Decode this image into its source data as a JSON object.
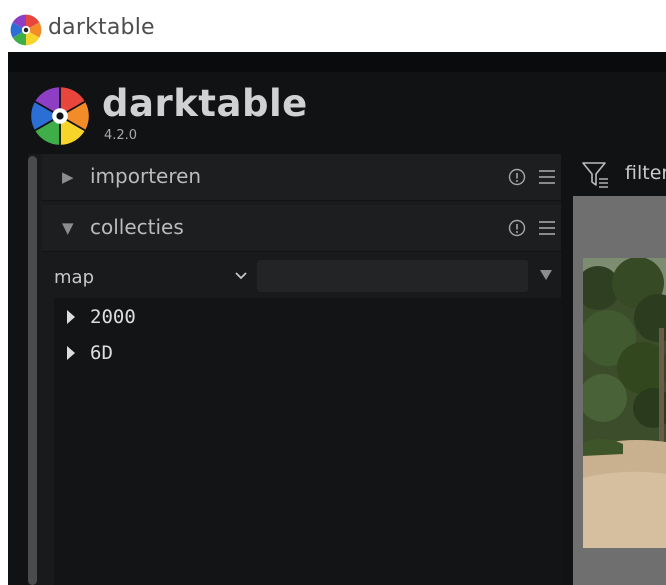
{
  "window": {
    "title": "darktable",
    "icon": "darktable-aperture-logo"
  },
  "brand": {
    "name": "darktable",
    "version": "4.2.0",
    "logo_icon": "darktable-aperture-logo"
  },
  "modules": {
    "import": {
      "label": "importeren",
      "expanded": false
    },
    "collections": {
      "label": "collecties",
      "expanded": true
    }
  },
  "collections": {
    "property": "map",
    "search_value": "",
    "tree": [
      {
        "label": "2000"
      },
      {
        "label": "6D"
      }
    ]
  },
  "toolbar": {
    "filter_label": "filter"
  },
  "icons": {
    "info": "info-icon",
    "menu": "hamburger-menu-icon",
    "filter": "filter-icon",
    "expand": "triangle-right-icon",
    "collapse": "triangle-down-icon"
  },
  "colors": {
    "background": "#111213",
    "panel": "#191a1b",
    "text": "#b9bbbd"
  }
}
